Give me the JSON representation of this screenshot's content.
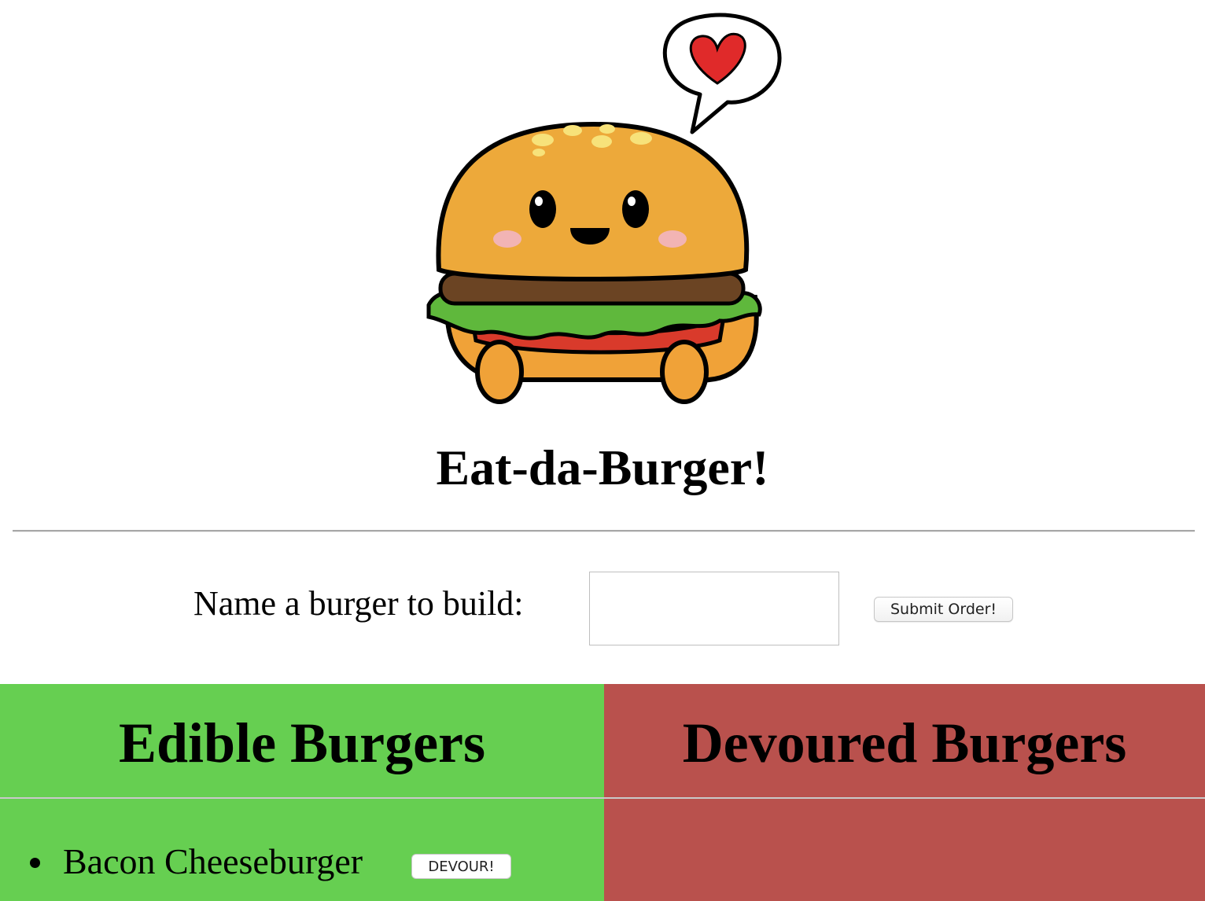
{
  "header": {
    "title": "Eat-da-Burger!"
  },
  "hero": {
    "icon": "burger-mascot-heart-icon"
  },
  "order_form": {
    "label": "Name a burger to build:",
    "input_value": "",
    "input_placeholder": "",
    "submit_label": "Submit Order!"
  },
  "edible": {
    "title": "Edible Burgers",
    "color": "#66cf51",
    "items": [
      {
        "name": "Bacon Cheeseburger",
        "action_label": "DEVOUR!"
      }
    ]
  },
  "devoured": {
    "title": "Devoured Burgers",
    "color": "#b9514d",
    "items": []
  }
}
